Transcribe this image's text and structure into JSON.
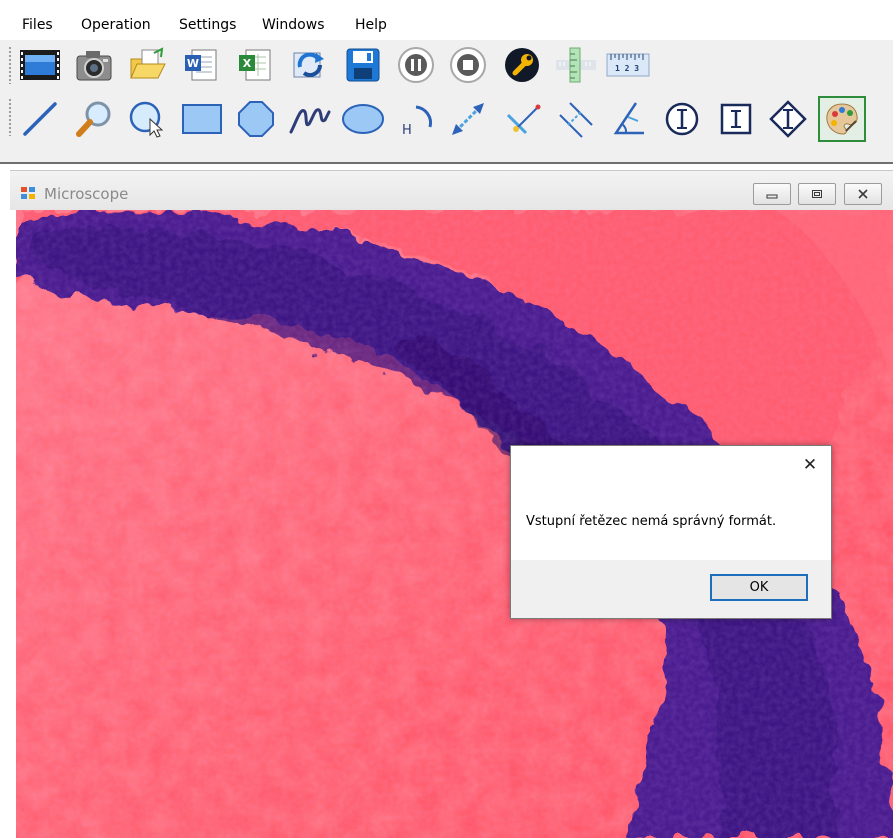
{
  "menu": {
    "items": [
      {
        "label": "Files"
      },
      {
        "label": "Operation"
      },
      {
        "label": "Settings"
      },
      {
        "label": "Windows"
      },
      {
        "label": "Help"
      }
    ]
  },
  "toolbar": {
    "row1": [
      "video-icon",
      "camera-icon",
      "open-folder-icon",
      "word-export-icon",
      "excel-export-icon",
      "refresh-icon",
      "save-icon",
      "pause-icon",
      "stop-icon",
      "wrench-icon",
      "vertical-ruler-icon",
      "horizontal-ruler-icon"
    ],
    "row2": [
      "line-tool-icon",
      "zoom-icon",
      "circle-select-icon",
      "rectangle-tool-icon",
      "polygon-tool-icon",
      "freehand-tool-icon",
      "ellipse-tool-icon",
      "arc-tool-icon",
      "distance-tool-icon",
      "point-line-tool-icon",
      "parallel-lines-tool-icon",
      "angle-tool-icon",
      "circle-i-tool-icon",
      "square-i-tool-icon",
      "diamond-i-tool-icon",
      "palette-icon"
    ],
    "ruler_label": "1 2 3"
  },
  "child_window": {
    "title": "Microscope",
    "controls": [
      "minimize-icon",
      "restore-icon",
      "close-icon"
    ]
  },
  "dialog": {
    "message": "Vstupní řetězec nemá správný formát.",
    "ok_label": "OK",
    "close_glyph": "✕"
  },
  "colors": {
    "tissue_pink": "#ff5b6b",
    "stain_purple": "#4a1f8f",
    "selected_border": "#2d8d3a",
    "button_focus": "#1d6fbd"
  }
}
